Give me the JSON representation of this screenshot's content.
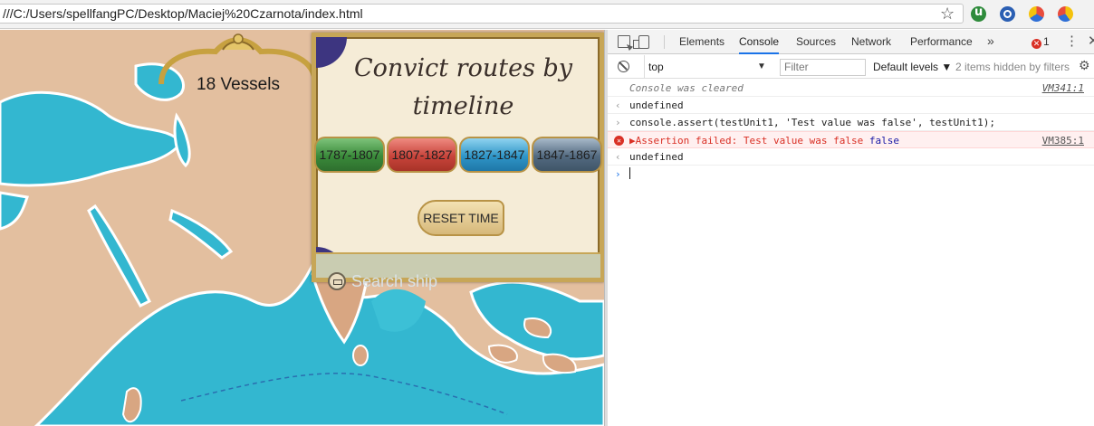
{
  "browser": {
    "url": "///C:/Users/spellfangPC/Desktop/Maciej%20Czarnota/index.html",
    "extensions": [
      "utorrent-icon",
      "extension-blue-icon",
      "extension-pie-icon",
      "extension-chart-icon"
    ]
  },
  "page": {
    "vessels_label": "18 Vessels",
    "panel_title": "Convict routes by timeline",
    "periods": [
      "1787-1807",
      "1807-1827",
      "1827-1847",
      "1847-1867"
    ],
    "period_colors": [
      "#3a8a3a",
      "#c8443b",
      "#2f95c7",
      "#536a80"
    ],
    "reset_label": "RESET TIME",
    "search_placeholder": "Search ship",
    "colors": {
      "ocean": "#33b7d0",
      "land": "#e2bc9d",
      "gold": "#c7a657"
    }
  },
  "devtools": {
    "tabs": [
      "Elements",
      "Console",
      "Sources",
      "Network",
      "Performance"
    ],
    "active_tab": "Console",
    "more_tabs": "»",
    "error_count": "1",
    "context": "top",
    "filter_placeholder": "Filter",
    "levels": "Default levels",
    "hidden": "2 items hidden by filters",
    "rows": [
      {
        "type": "info",
        "text": "Console was cleared",
        "source": "VM341:1"
      },
      {
        "type": "result",
        "text": "undefined"
      },
      {
        "type": "input",
        "text": "console.assert(testUnit1, 'Test value was false', testUnit1);"
      },
      {
        "type": "error",
        "prefix": "▶Assertion failed: Test value was false",
        "value": "false",
        "source": "VM385:1"
      },
      {
        "type": "result",
        "text": "undefined"
      }
    ]
  }
}
